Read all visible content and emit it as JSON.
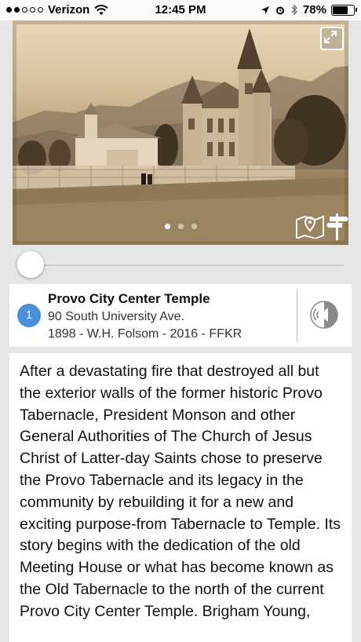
{
  "status_bar": {
    "carrier": "Verizon",
    "time": "12:45 PM",
    "battery": "78%",
    "battery_level": 0.78
  },
  "photo": {
    "carousel_count": 3,
    "carousel_active": 1
  },
  "slider": {
    "value": 0
  },
  "place": {
    "number": "1",
    "title": "Provo City Center Temple",
    "address": "90 South University Ave.",
    "credits": "1898 - W.H. Folsom - 2016 - FFKR"
  },
  "description": "After a devastating fire that destroyed all but the exterior walls of the former historic Provo Tabernacle, President Monson and other General Authorities of The Church of Jesus Christ of Latter-day Saints chose to preserve the Provo Tabernacle and its legacy in the community by rebuilding it for a new and exciting purpose-from Tabernacle to Temple. Its story begins with the dedication of the old Meeting House or what has become known as the Old Tabernacle to the north of the current Provo City Center Temple. Brigham Young,",
  "icons": {
    "wifi": "wifi-icon",
    "location": "location-arrow-icon",
    "alarm": "alarm-icon",
    "bluetooth": "bluetooth-icon",
    "battery": "battery-icon",
    "expand": "expand-icon",
    "map": "map-pin-icon",
    "signpost": "signpost-icon",
    "audio": "audio-speaker-icon"
  },
  "colors": {
    "badge": "#4a90d9",
    "background": "#e6e6e6"
  }
}
